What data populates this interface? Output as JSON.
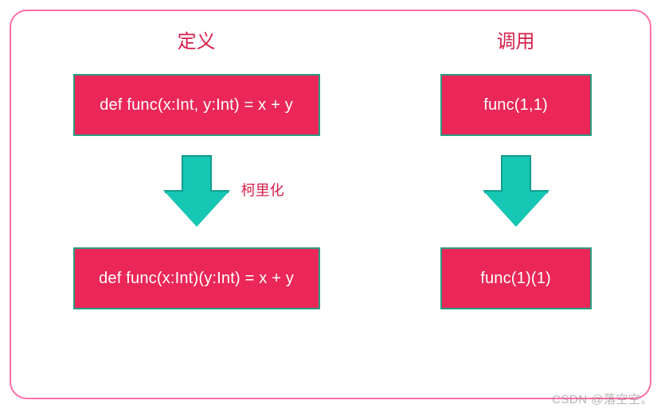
{
  "headings": {
    "definition": "定义",
    "call": "调用"
  },
  "code": {
    "def_before": "def func(x:Int, y:Int) = x + y",
    "def_after": "def func(x:Int)(y:Int) = x + y",
    "call_before": "func(1,1)",
    "call_after": "func(1)(1)"
  },
  "arrow_label": "柯里化",
  "watermark": "CSDN @落空空。"
}
